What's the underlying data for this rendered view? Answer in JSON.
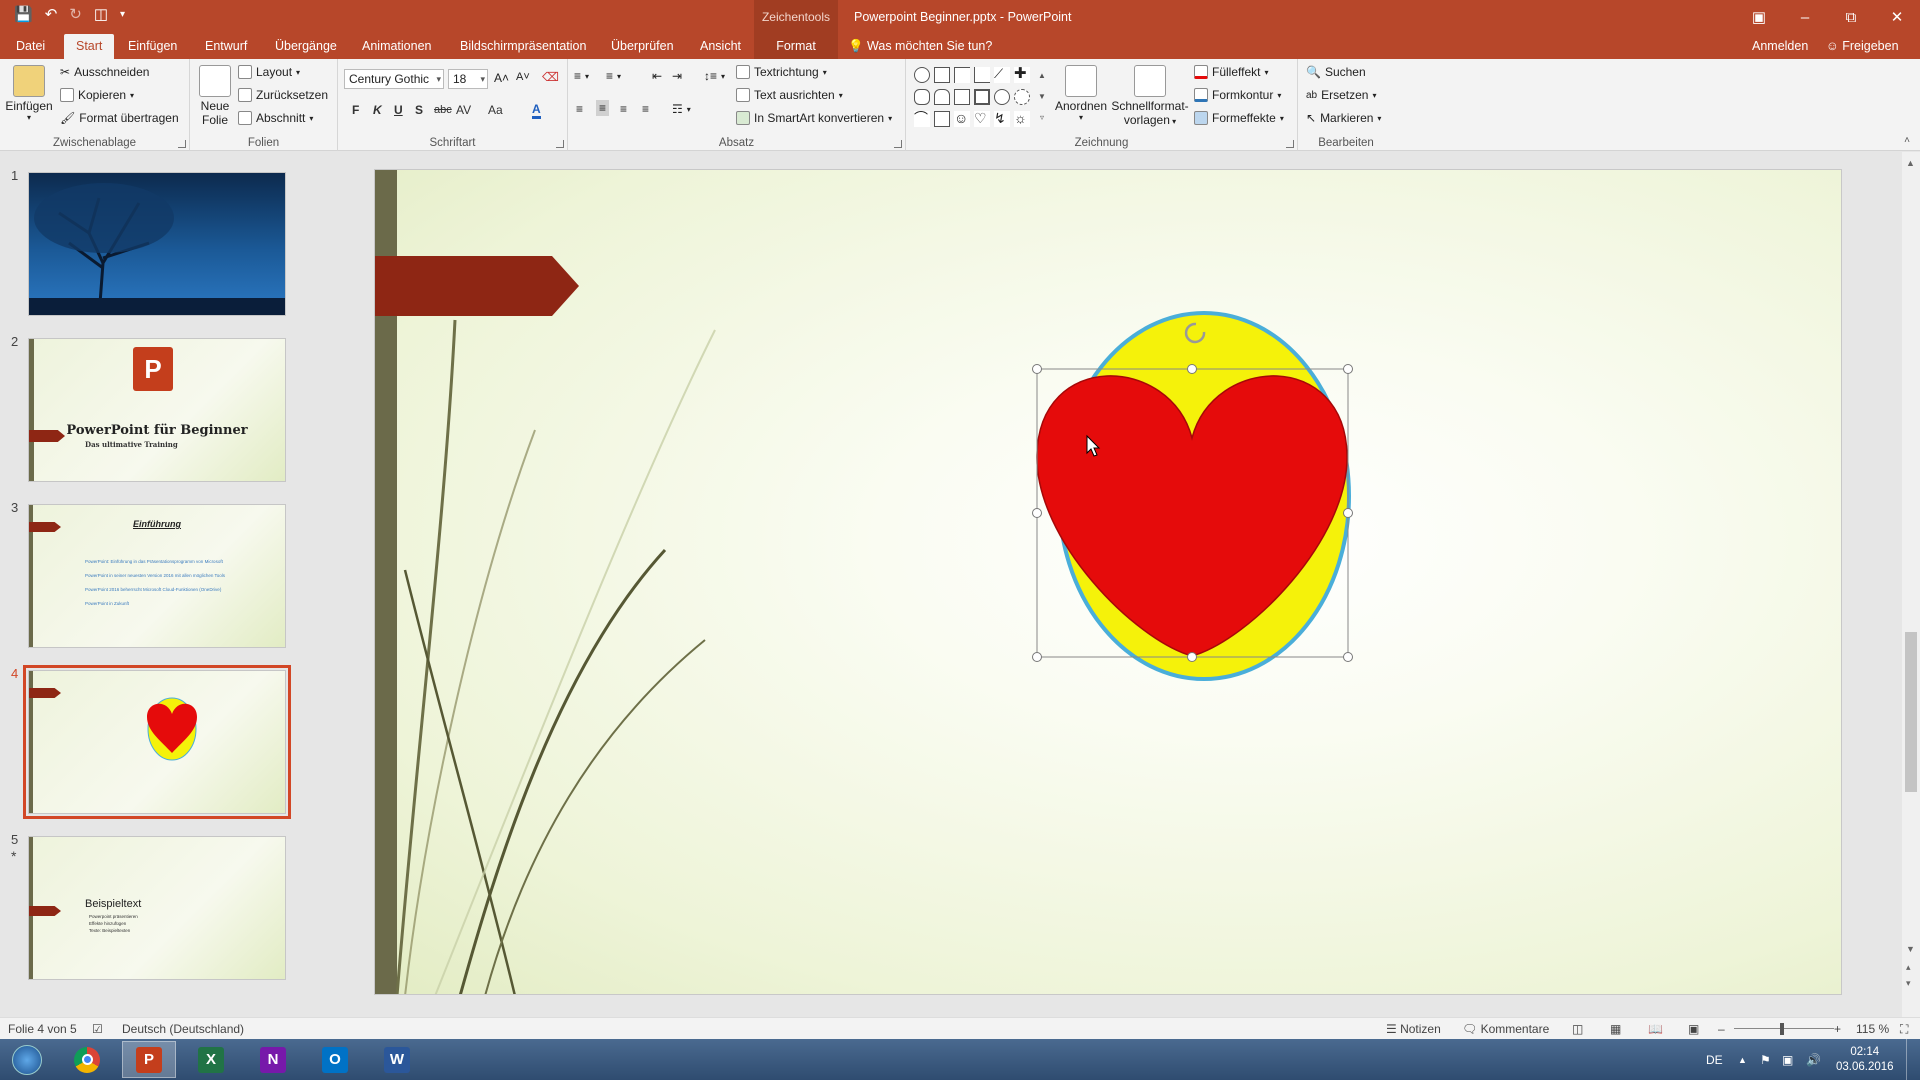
{
  "titlebar": {
    "context_tab": "Zeichentools",
    "title": "Powerpoint Beginner.pptx - PowerPoint",
    "qat_icons": [
      "save-icon",
      "undo-icon",
      "redo-icon",
      "presentation-start-icon",
      "customize-qat-icon"
    ]
  },
  "tabs": [
    {
      "label": "Datei"
    },
    {
      "label": "Start"
    },
    {
      "label": "Einfügen"
    },
    {
      "label": "Entwurf"
    },
    {
      "label": "Übergänge"
    },
    {
      "label": "Animationen"
    },
    {
      "label": "Bildschirmpräsentation"
    },
    {
      "label": "Überprüfen"
    },
    {
      "label": "Ansicht"
    },
    {
      "label": "Format"
    }
  ],
  "tell_me": "Was möchten Sie tun?",
  "account": {
    "signin": "Anmelden",
    "share": "Freigeben"
  },
  "ribbon": {
    "clipboard": {
      "label": "Zwischenablage",
      "paste": "Einfügen",
      "cut": "Ausschneiden",
      "copy": "Kopieren",
      "format_painter": "Format übertragen"
    },
    "slides": {
      "label": "Folien",
      "new_slide": "Neue Folie",
      "layout": "Layout",
      "reset": "Zurücksetzen",
      "section": "Abschnitt"
    },
    "font": {
      "label": "Schriftart",
      "family": "Century Gothic",
      "size": "18",
      "bold": "F",
      "italic": "K",
      "underline": "U",
      "shadow": "S",
      "strike": "abc",
      "spacing": "AV",
      "case": "Aa",
      "color": "A"
    },
    "paragraph": {
      "label": "Absatz",
      "text_direction": "Textrichtung",
      "align_text": "Text ausrichten",
      "smartart": "In SmartArt konvertieren"
    },
    "drawing": {
      "label": "Zeichnung",
      "arrange": "Anordnen",
      "quick_styles_1": "Schnellformat-",
      "quick_styles_2": "vorlagen",
      "fill": "Fülleffekt",
      "outline": "Formkontur",
      "effects": "Formeffekte"
    },
    "editing": {
      "label": "Bearbeiten",
      "find": "Suchen",
      "replace": "Ersetzen",
      "select": "Markieren"
    }
  },
  "slides": [
    {
      "num": "1"
    },
    {
      "num": "2",
      "title": "PowerPoint für Beginner",
      "subtitle": "Das ultimative Training"
    },
    {
      "num": "3",
      "title": "Einführung",
      "bullets": [
        "PowerPoint: Einführung in das Präsentationsprogramm von Microsoft",
        "PowerPoint in seiner neuesten Version 2016 mit allen möglichen Tools",
        "PowerPoint 2016 beherrscht Microsoft Cloud-Funktionen (OneDrive)",
        "PowerPoint in Zukunft"
      ]
    },
    {
      "num": "4"
    },
    {
      "num": "5",
      "marker": "*",
      "title": "Beispieltext",
      "bullets": [
        "Powerpoint präsentieren",
        "Effekte hinzufügen",
        "Texte: Beispieltexten"
      ]
    }
  ],
  "status": {
    "slide_of": "Folie 4 von 5",
    "language": "Deutsch (Deutschland)",
    "notes": "Notizen",
    "comments": "Kommentare",
    "zoom": "115 %"
  },
  "taskbar": {
    "apps": [
      {
        "name": "windows-start-icon"
      },
      {
        "name": "chrome-icon"
      },
      {
        "name": "powerpoint-icon",
        "letter": "P",
        "color": "#c43e1c"
      },
      {
        "name": "excel-icon",
        "letter": "X",
        "color": "#217346"
      },
      {
        "name": "onenote-icon",
        "letter": "N",
        "color": "#7719aa"
      },
      {
        "name": "outlook-icon",
        "letter": "O",
        "color": "#0072c6"
      },
      {
        "name": "word-icon",
        "letter": "W",
        "color": "#2b579a"
      }
    ],
    "lang": "DE",
    "time": "02:14",
    "date": "03.06.2016"
  },
  "colors": {
    "accent": "#b7472a",
    "heart": "#e50b0b",
    "ellipse": "#f5f20a",
    "ellipse_outline": "#4aaed9",
    "banner": "#8e2614"
  }
}
